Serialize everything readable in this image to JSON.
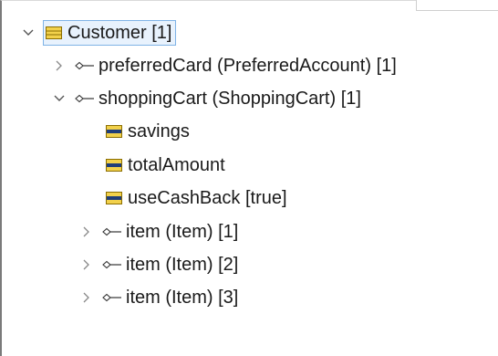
{
  "tree": {
    "root": {
      "label": "Customer [1]",
      "icon": "class-icon",
      "expanded": true,
      "selected": true,
      "icon_color": "#f2d14b"
    },
    "children": [
      {
        "label": "preferredCard (PreferredAccount) [1]",
        "icon": "association-icon",
        "expanded": false
      },
      {
        "label": "shoppingCart (ShoppingCart) [1]",
        "icon": "association-icon",
        "expanded": true,
        "children": [
          {
            "label": "savings",
            "icon": "attribute-icon"
          },
          {
            "label": "totalAmount",
            "icon": "attribute-icon"
          },
          {
            "label": "useCashBack [true]",
            "icon": "attribute-icon"
          },
          {
            "label": "item (Item) [1]",
            "icon": "association-icon",
            "expanded": false
          },
          {
            "label": "item (Item) [2]",
            "icon": "association-icon",
            "expanded": false
          },
          {
            "label": "item (Item) [3]",
            "icon": "association-icon",
            "expanded": false
          }
        ]
      }
    ]
  },
  "colors": {
    "selection_border": "#7fb3e6",
    "selection_fill": "#e8f2fd",
    "attribute_icon_fill": "#f2d14b",
    "attribute_icon_bar": "#1f3d7a"
  }
}
